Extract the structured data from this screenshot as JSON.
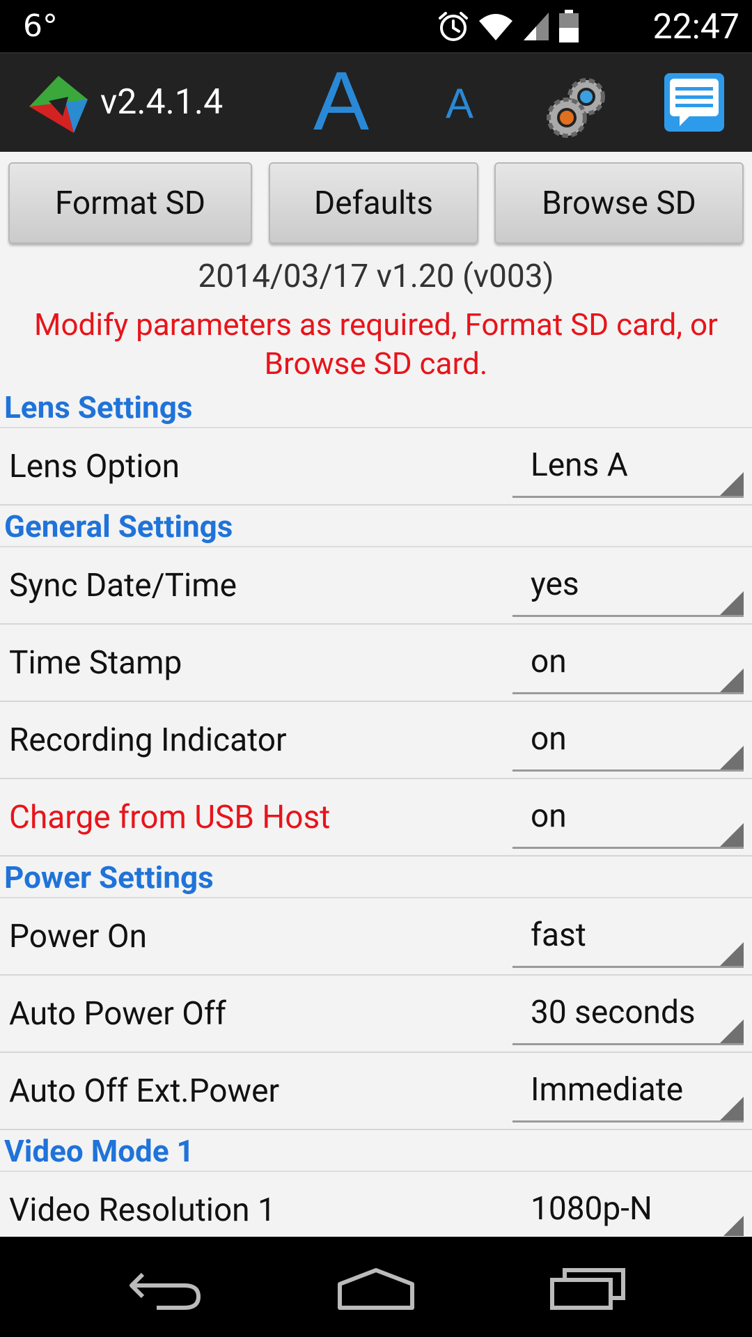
{
  "status_bar": {
    "temperature": "6°",
    "time": "22:47",
    "icons": [
      "alarm-icon",
      "wifi-icon",
      "signal-icon",
      "battery-icon"
    ]
  },
  "action_bar": {
    "version": "v2.4.1.4",
    "font_large_label": "A",
    "font_small_label": "A",
    "icons": [
      "app-logo-icon",
      "settings-gear-icon",
      "chat-icon"
    ]
  },
  "buttons": {
    "format_sd": "Format SD",
    "defaults": "Defaults",
    "browse_sd": "Browse SD"
  },
  "firmware_line": "2014/03/17 v1.20 (v003)",
  "help_text_line1": "Modify parameters as required, Format SD card, or",
  "help_text_line2": "Browse SD card.",
  "sections": {
    "lens": {
      "title": "Lens Settings",
      "rows": [
        {
          "label": "Lens Option",
          "value": "Lens A"
        }
      ]
    },
    "general": {
      "title": "General Settings",
      "rows": [
        {
          "label": "Sync Date/Time",
          "value": "yes"
        },
        {
          "label": "Time Stamp",
          "value": "on"
        },
        {
          "label": "Recording Indicator",
          "value": "on"
        },
        {
          "label": "Charge from USB Host",
          "value": "on"
        }
      ]
    },
    "power": {
      "title": "Power Settings",
      "rows": [
        {
          "label": "Power On",
          "value": "fast"
        },
        {
          "label": "Auto Power Off",
          "value": "30 seconds"
        },
        {
          "label": "Auto Off Ext.Power",
          "value": "Immediate"
        }
      ]
    },
    "video1": {
      "title": "Video Mode 1",
      "rows": [
        {
          "label": "Video Resolution 1",
          "value": "1080p-N"
        }
      ]
    }
  },
  "colors": {
    "section_header": "#1f73d9",
    "warning_text": "#e8141a",
    "accent_font_icon": "#2a89d6"
  },
  "nav_bar": {
    "icons": [
      "back-icon",
      "home-icon",
      "recent-apps-icon"
    ]
  }
}
